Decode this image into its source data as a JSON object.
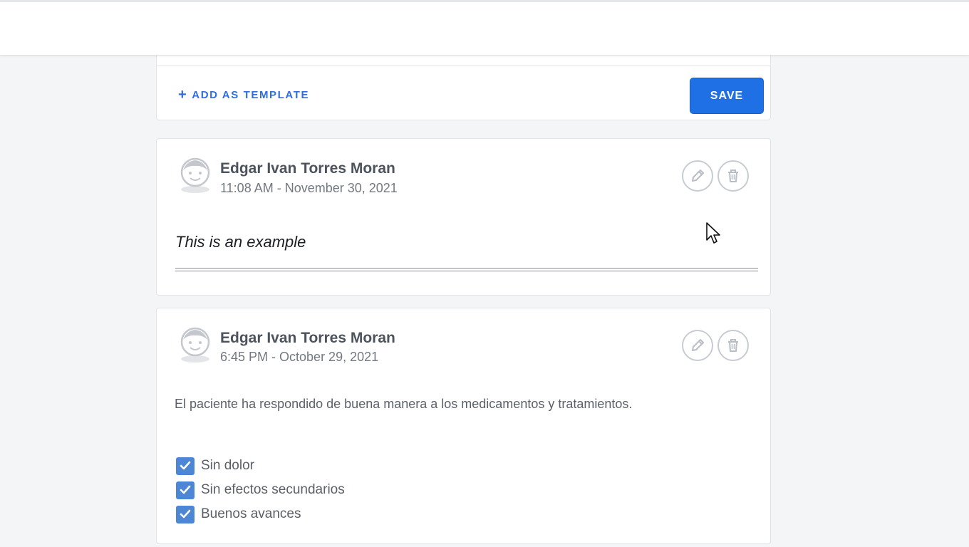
{
  "editor": {
    "add_template_label": "ADD AS TEMPLATE",
    "save_label": "SAVE"
  },
  "notes": [
    {
      "author": "Edgar Ivan Torres Moran",
      "timestamp": "11:08 AM - November 30, 2021",
      "text": "This is an example"
    },
    {
      "author": "Edgar Ivan Torres Moran",
      "timestamp": "6:45 PM - October 29, 2021",
      "text": "El paciente ha respondido de buena manera a los medicamentos y tratamientos.",
      "checklist": [
        {
          "label": "Sin dolor",
          "checked": true
        },
        {
          "label": "Sin efectos secundarios",
          "checked": true
        },
        {
          "label": "Buenos avances",
          "checked": true
        }
      ]
    }
  ],
  "icons": {
    "edit": "pencil-icon",
    "delete": "trash-icon",
    "avatar": "avatar-icon",
    "add": "plus-icon",
    "check": "check-icon"
  },
  "colors": {
    "accent": "#1f6fe5",
    "link": "#2f6ee0",
    "checkbox": "#4e86d6"
  }
}
